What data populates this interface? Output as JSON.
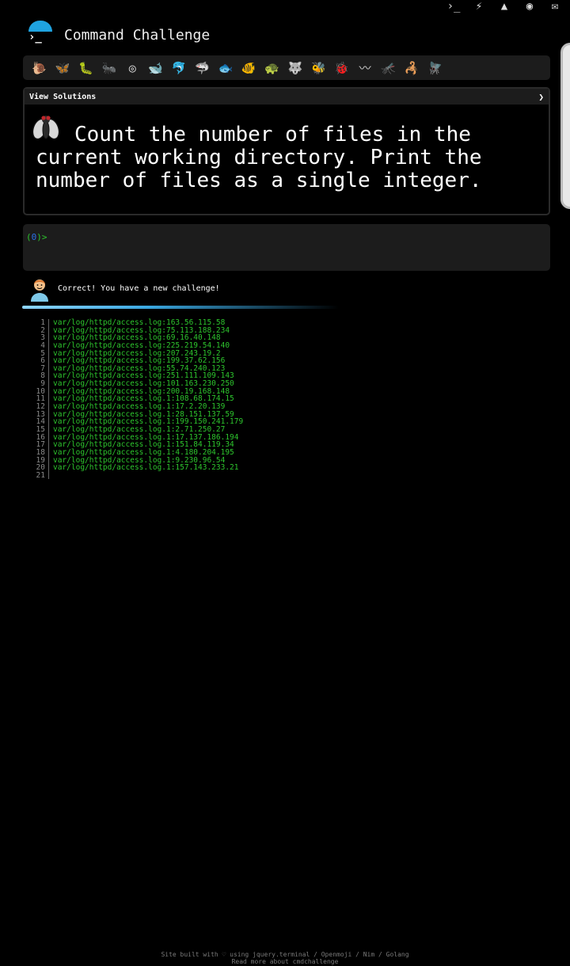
{
  "top_icons": [
    {
      "name": "terminal-icon",
      "glyph": "›_"
    },
    {
      "name": "bolt-icon",
      "glyph": "⚡"
    },
    {
      "name": "tree-icon",
      "glyph": "▲"
    },
    {
      "name": "fox-icon",
      "glyph": "◉"
    },
    {
      "name": "mail-icon",
      "glyph": "✉"
    }
  ],
  "header": {
    "logo_prompt": "›_",
    "title": "Command Challenge"
  },
  "creatures": [
    {
      "name": "snail-icon",
      "glyph": "🐌"
    },
    {
      "name": "butterfly-icon",
      "glyph": "🦋"
    },
    {
      "name": "caterpillar-icon",
      "glyph": "🐛"
    },
    {
      "name": "ant-icon",
      "glyph": "🐜"
    },
    {
      "name": "shell-icon",
      "glyph": "◎"
    },
    {
      "name": "whale-icon",
      "glyph": "🐋"
    },
    {
      "name": "dolphin-icon",
      "glyph": "🐬"
    },
    {
      "name": "shark-icon",
      "glyph": "🦈"
    },
    {
      "name": "fish-icon",
      "glyph": "🐟"
    },
    {
      "name": "tropical-fish-icon",
      "glyph": "🐠"
    },
    {
      "name": "turtle-icon",
      "glyph": "🐢"
    },
    {
      "name": "wolf-icon",
      "glyph": "🐺"
    },
    {
      "name": "bee-icon",
      "glyph": "🐝"
    },
    {
      "name": "ladybug-icon",
      "glyph": "🐞"
    },
    {
      "name": "worm-icon",
      "glyph": "〰"
    },
    {
      "name": "mosquito-icon",
      "glyph": "🦟"
    },
    {
      "name": "scorpion-icon",
      "glyph": "🦂"
    },
    {
      "name": "fly-icon",
      "glyph": "🪰"
    }
  ],
  "solutions": {
    "label": "View Solutions",
    "arrow": "❯"
  },
  "challenge": {
    "text": "Count the number of files in the current working directory. Print the number of files as a single integer."
  },
  "terminal": {
    "prompt_open": "(",
    "prompt_num": "0",
    "prompt_close": ")>"
  },
  "status": {
    "message": "Correct! You have a new challenge!"
  },
  "output": [
    {
      "n": "1",
      "t": "var/log/httpd/access.log:163.56.115.58"
    },
    {
      "n": "2",
      "t": "var/log/httpd/access.log:75.113.188.234"
    },
    {
      "n": "3",
      "t": "var/log/httpd/access.log:69.16.40.148"
    },
    {
      "n": "4",
      "t": "var/log/httpd/access.log:225.219.54.140"
    },
    {
      "n": "5",
      "t": "var/log/httpd/access.log:207.243.19.2"
    },
    {
      "n": "6",
      "t": "var/log/httpd/access.log:199.37.62.156"
    },
    {
      "n": "7",
      "t": "var/log/httpd/access.log:55.74.240.123"
    },
    {
      "n": "8",
      "t": "var/log/httpd/access.log:251.111.109.143"
    },
    {
      "n": "9",
      "t": "var/log/httpd/access.log:101.163.230.250"
    },
    {
      "n": "10",
      "t": "var/log/httpd/access.log:200.19.168.148"
    },
    {
      "n": "11",
      "t": "var/log/httpd/access.log.1:108.68.174.15"
    },
    {
      "n": "12",
      "t": "var/log/httpd/access.log.1:17.2.20.139"
    },
    {
      "n": "13",
      "t": "var/log/httpd/access.log.1:28.151.137.59"
    },
    {
      "n": "14",
      "t": "var/log/httpd/access.log.1:199.150.241.179"
    },
    {
      "n": "15",
      "t": "var/log/httpd/access.log.1:2.71.250.27"
    },
    {
      "n": "16",
      "t": "var/log/httpd/access.log.1:17.137.186.194"
    },
    {
      "n": "17",
      "t": "var/log/httpd/access.log.1:151.84.119.34"
    },
    {
      "n": "18",
      "t": "var/log/httpd/access.log.1:4.180.204.195"
    },
    {
      "n": "19",
      "t": "var/log/httpd/access.log.1:9.230.96.54"
    },
    {
      "n": "20",
      "t": "var/log/httpd/access.log.1:157.143.233.21"
    },
    {
      "n": "21",
      "t": ""
    }
  ],
  "footer": {
    "line1": "Site built with ♡ using jquery.terminal / Openmoji / Nim / Golang",
    "line2": "Read more about cmdchallenge"
  },
  "colors": {
    "accent": "#1fa3e0",
    "prompt_green": "#2dc52d",
    "prompt_blue": "#2a6ee8",
    "panel": "#1c1c1c"
  }
}
